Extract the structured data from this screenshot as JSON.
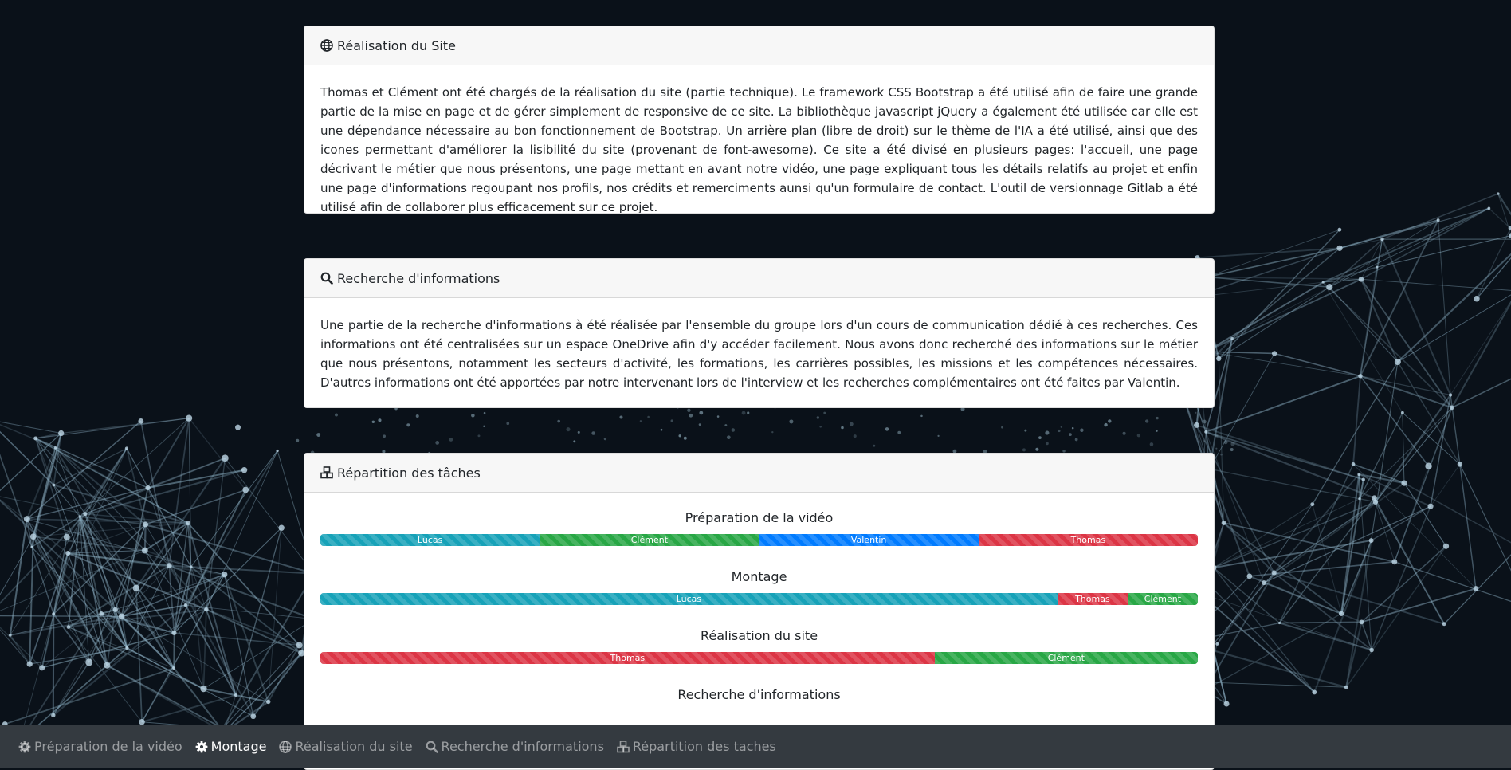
{
  "cards": {
    "site": {
      "title": "Réalisation du Site",
      "icon": "globe-icon",
      "body": "Thomas et Clément ont été chargés de la réalisation du site (partie technique). Le framework CSS Bootstrap a été utilisé afin de faire une grande partie de la mise en page et de gérer simplement de responsive de ce site. La bibliothèque javascript jQuery a également été utilisée car elle est une dépendance nécessaire au bon fonctionnement de Bootstrap. Un arrière plan (libre de droit) sur le thème de l'IA a été utilisé, ainsi que des icones permettant d'améliorer la lisibilité du site (provenant de font-awesome). Ce site a été divisé en plusieurs pages: l'accueil, une page décrivant le métier que nous présentons, une page mettant en avant notre vidéo, une page expliquant tous les détails relatifs au projet et enfin une page d'informations regoupant nos profils, nos crédits et remerciments aunsi qu'un formulaire de contact. L'outil de versionnage Gitlab a été utilisé afin de collaborer plus efficacement sur ce projet."
    },
    "research": {
      "title": "Recherche d'informations",
      "icon": "search-icon",
      "body": "Une partie de la recherche d'informations à été réalisée par l'ensemble du groupe lors d'un cours de communication dédié à ces recherches. Ces informations ont été centralisées sur un espace OneDrive afin d'y accéder facilement. Nous avons donc recherché des informations sur le métier que nous présentons, notamment les secteurs d'activité, les formations, les carrières possibles, les missions et les compétences nécessaires. D'autres informations ont été apportées par notre intervenant lors de l'interview et les recherches complémentaires ont été faites par Valentin."
    },
    "tasks": {
      "title": "Répartition des tâches",
      "icon": "cubes-icon",
      "groups": [
        {
          "title": "Préparation de la vidéo",
          "segments": [
            {
              "name": "Lucas",
              "percent": 25,
              "color": "#17a2b8"
            },
            {
              "name": "Clément",
              "percent": 25,
              "color": "#28a745"
            },
            {
              "name": "Valentin",
              "percent": 25,
              "color": "#007bff"
            },
            {
              "name": "Thomas",
              "percent": 25,
              "color": "#dc3545"
            }
          ]
        },
        {
          "title": "Montage",
          "segments": [
            {
              "name": "Lucas",
              "percent": 84,
              "color": "#17a2b8"
            },
            {
              "name": "Thomas",
              "percent": 8,
              "color": "#dc3545"
            },
            {
              "name": "Clément",
              "percent": 8,
              "color": "#28a745"
            }
          ]
        },
        {
          "title": "Réalisation du site",
          "segments": [
            {
              "name": "Thomas",
              "percent": 70,
              "color": "#dc3545"
            },
            {
              "name": "Clément",
              "percent": 30,
              "color": "#28a745"
            }
          ]
        },
        {
          "title": "Recherche d'informations",
          "segments": []
        }
      ]
    }
  },
  "navbar": {
    "items": [
      {
        "label": "Préparation de la vidéo",
        "icon": "cog-icon",
        "active": false
      },
      {
        "label": "Montage",
        "icon": "cog-icon",
        "active": true
      },
      {
        "label": "Réalisation du site",
        "icon": "globe-icon",
        "active": false
      },
      {
        "label": "Recherche d'informations",
        "icon": "search-icon",
        "active": false
      },
      {
        "label": "Répartition des taches",
        "icon": "cubes-icon",
        "active": false
      }
    ]
  }
}
